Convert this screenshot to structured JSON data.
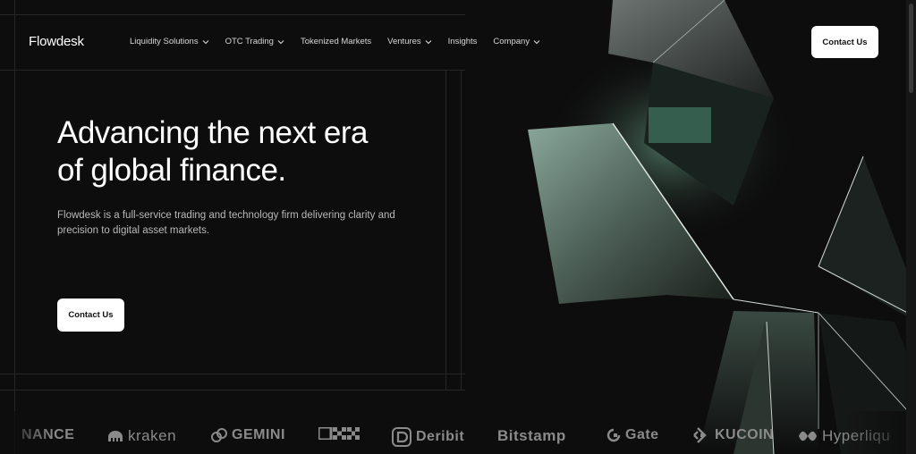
{
  "brand": {
    "name": "Flowdesk"
  },
  "nav": {
    "items": [
      {
        "label": "Liquidity Solutions",
        "has_dropdown": true
      },
      {
        "label": "OTC Trading",
        "has_dropdown": true
      },
      {
        "label": "Tokenized Markets",
        "has_dropdown": false
      },
      {
        "label": "Ventures",
        "has_dropdown": true
      },
      {
        "label": "Insights",
        "has_dropdown": false
      },
      {
        "label": "Company",
        "has_dropdown": true
      }
    ],
    "contact_label": "Contact Us"
  },
  "hero": {
    "title_line1": "Advancing the next era",
    "title_line2": "of global finance.",
    "subtitle": "Flowdesk is a full-service trading and technology firm delivering clarity and precision to digital asset markets.",
    "cta_label": "Contact Us"
  },
  "partners": [
    {
      "name": "NANCE",
      "icon": "binance-logo"
    },
    {
      "name": "kraken",
      "icon": "kraken-logo"
    },
    {
      "name": "GEMINI",
      "icon": "gemini-logo"
    },
    {
      "name": "OKX",
      "icon": "okx-logo"
    },
    {
      "name": "Deribit",
      "icon": "deribit-logo"
    },
    {
      "name": "Bitstamp",
      "icon": "bitstamp-logo"
    },
    {
      "name": "Gate",
      "icon": "gate-logo"
    },
    {
      "name": "KUCOIN",
      "icon": "kucoin-logo"
    },
    {
      "name": "Hyperliqu",
      "icon": "hyperliquid-logo"
    }
  ],
  "colors": {
    "background": "#0d0d0d",
    "text": "#ffffff",
    "muted": "#b9b9b9",
    "accent": "#6f9a88"
  }
}
